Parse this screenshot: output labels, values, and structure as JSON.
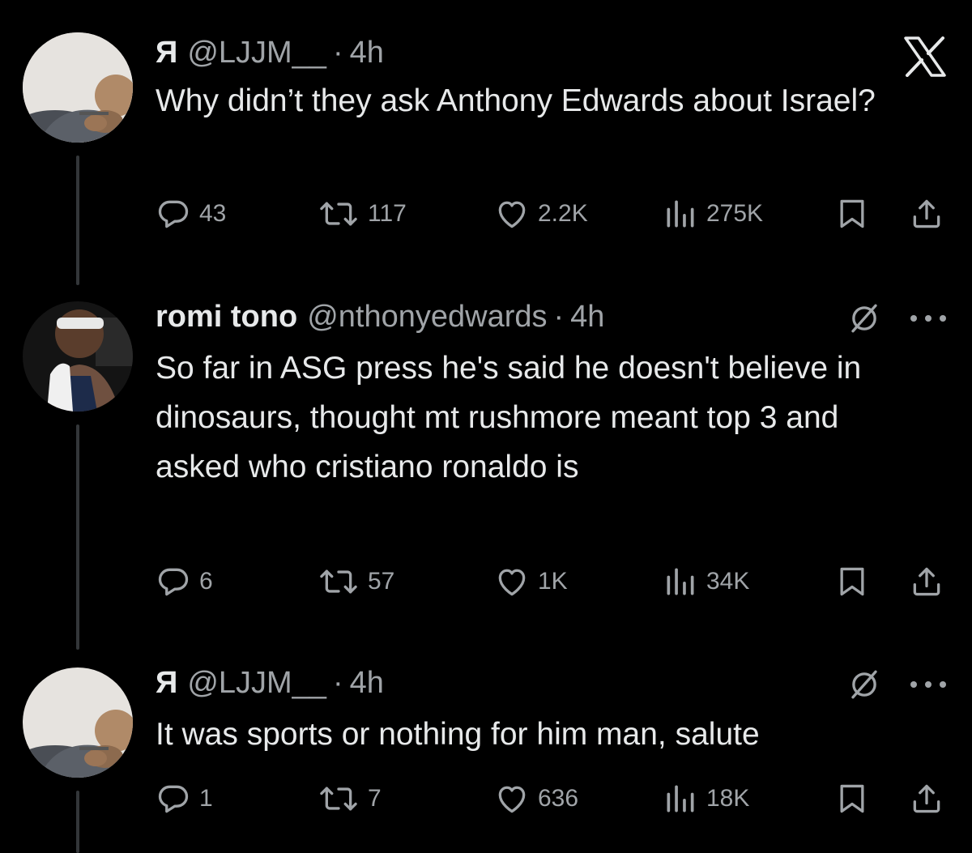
{
  "posts": [
    {
      "display_name": "Я",
      "handle": "@LJJM__",
      "separator": "·",
      "time": "4h",
      "text": "Why didn’t they ask Anthony Edwards about Israel?",
      "replies": "43",
      "reposts": "117",
      "likes": "2.2K",
      "views": "275K"
    },
    {
      "display_name": "romi tono",
      "handle": "@nthonyedwards",
      "separator": "·",
      "time": "4h",
      "text": "So far in ASG press he's said he doesn't believe in dinosaurs, thought mt rushmore meant top 3 and asked who cristiano ronaldo is",
      "replies": "6",
      "reposts": "57",
      "likes": "1K",
      "views": "34K"
    },
    {
      "display_name": "Я",
      "handle": "@LJJM__",
      "separator": "·",
      "time": "4h",
      "text": "It was sports or nothing for him man, salute",
      "replies": "1",
      "reposts": "7",
      "likes": "636",
      "views": "18K"
    }
  ],
  "colors": {
    "background": "#000000",
    "primary_text": "#e7e9ea",
    "secondary_text": "#a0a4a8",
    "thread_line": "#333639"
  },
  "icons": [
    "x-logo-icon",
    "reply-icon",
    "repost-icon",
    "like-icon",
    "views-icon",
    "bookmark-icon",
    "share-icon",
    "grok-slash-icon",
    "more-icon"
  ]
}
